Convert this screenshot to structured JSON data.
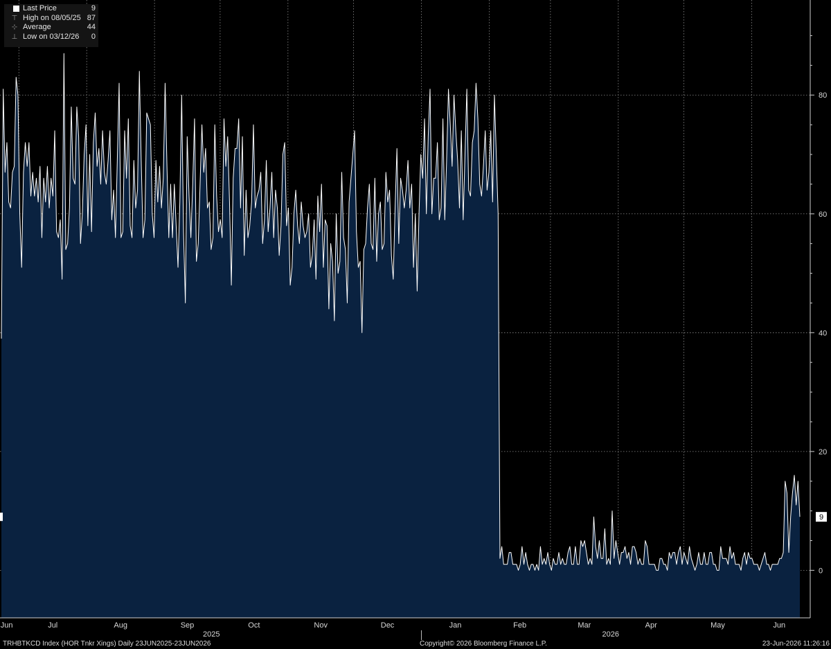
{
  "legend": {
    "last_price_label": "Last Price",
    "last_price_value": "9",
    "high_label": "High on 08/05/25",
    "high_value": "87",
    "average_label": "Average",
    "average_value": "44",
    "low_label": "Low on 03/12/26",
    "low_value": "0"
  },
  "footer": {
    "left": "TRHBTKCD Index (HOR Tnkr Xings) Daily 23JUN2025-23JUN2026",
    "middle": "Copyright© 2026 Bloomberg Finance L.P.",
    "right": "23-Jun-2026 11:26:16"
  },
  "colors": {
    "background": "#000000",
    "area_fill": "#0a2240",
    "line": "#ffffff",
    "grid": "#8c8c8c",
    "text": "#d8d8d8"
  },
  "chart_data": {
    "type": "area",
    "title": "",
    "xlabel": "",
    "ylabel": "",
    "ylim": [
      -8,
      96
    ],
    "yticks": [
      0,
      20,
      40,
      60,
      80
    ],
    "last_value_badge": "9",
    "grid": "dotted",
    "legend_position": "top-left",
    "x_month_labels": [
      "Jun",
      "Jul",
      "Aug",
      "Sep",
      "Oct",
      "Nov",
      "Dec",
      "Jan",
      "Feb",
      "Mar",
      "Apr",
      "May",
      "Jun"
    ],
    "x_year_labels": [
      "2025",
      "2026"
    ],
    "x_start": "2025-06-23",
    "x_end": "2026-06-23",
    "series": [
      {
        "values": [
          39,
          81,
          67,
          72,
          62,
          61,
          67,
          68,
          83,
          80,
          60,
          51,
          67,
          72,
          68,
          72,
          63,
          67,
          63,
          66,
          62,
          68,
          56,
          66,
          62,
          68,
          61,
          66,
          63,
          74,
          57,
          56,
          59,
          49,
          87,
          54,
          55,
          61,
          78,
          66,
          65,
          78,
          73,
          55,
          60,
          70,
          75,
          58,
          70,
          57,
          72,
          77,
          68,
          71,
          65,
          74,
          67,
          65,
          69,
          74,
          59,
          64,
          56,
          69,
          82,
          56,
          57,
          74,
          66,
          76,
          58,
          56,
          69,
          61,
          64,
          84,
          69,
          56,
          59,
          77,
          76,
          75,
          60,
          56,
          69,
          62,
          68,
          61,
          66,
          82,
          68,
          56,
          65,
          56,
          65,
          58,
          51,
          62,
          80,
          57,
          45,
          73,
          63,
          56,
          65,
          76,
          52,
          55,
          65,
          75,
          67,
          71,
          61,
          62,
          54,
          56,
          75,
          63,
          57,
          59,
          56,
          76,
          68,
          73,
          62,
          48,
          66,
          71,
          71,
          76,
          61,
          73,
          53,
          64,
          56,
          58,
          62,
          75,
          61,
          63,
          64,
          67,
          55,
          59,
          69,
          57,
          61,
          67,
          56,
          64,
          61,
          53,
          58,
          70,
          72,
          58,
          61,
          48,
          51,
          60,
          64,
          58,
          55,
          62,
          58,
          56,
          57,
          60,
          51,
          53,
          59,
          49,
          63,
          57,
          65,
          51,
          59,
          58,
          44,
          55,
          52,
          42,
          60,
          50,
          52,
          67,
          56,
          54,
          45,
          62,
          66,
          70,
          74,
          57,
          51,
          52,
          40,
          54,
          55,
          61,
          65,
          55,
          54,
          66,
          52,
          60,
          62,
          54,
          55,
          67,
          62,
          64,
          53,
          49,
          61,
          71,
          55,
          66,
          64,
          61,
          64,
          69,
          61,
          65,
          51,
          60,
          47,
          60,
          70,
          66,
          76,
          60,
          73,
          81,
          60,
          66,
          66,
          72,
          59,
          61,
          76,
          59,
          69,
          81,
          75,
          68,
          80,
          74,
          69,
          61,
          74,
          59,
          70,
          81,
          64,
          63,
          72,
          74,
          82,
          76,
          65,
          63,
          68,
          74,
          64,
          67,
          74,
          62,
          80,
          70,
          60,
          2,
          4,
          1,
          1,
          1,
          3,
          3,
          1,
          1,
          1,
          0,
          1,
          4,
          1,
          3,
          1,
          0,
          1,
          1,
          0,
          1,
          0,
          4,
          1,
          2,
          1,
          3,
          1,
          0,
          2,
          1,
          1,
          3,
          1,
          2,
          1,
          1,
          3,
          4,
          1,
          1,
          4,
          1,
          1,
          5,
          4,
          5,
          3,
          1,
          2,
          1,
          9,
          4,
          2,
          5,
          2,
          2,
          7,
          1,
          2,
          1,
          10,
          2,
          5,
          3,
          1,
          3,
          3,
          4,
          2,
          3,
          1,
          4,
          4,
          3,
          1,
          2,
          1,
          1,
          5,
          4,
          1,
          1,
          1,
          1,
          0,
          0,
          2,
          2,
          1,
          1,
          0,
          3,
          2,
          3,
          3,
          1,
          3,
          4,
          1,
          3,
          2,
          1,
          4,
          2,
          1,
          0,
          1,
          3,
          1,
          1,
          3,
          1,
          1,
          3,
          3,
          1,
          1,
          0,
          0,
          4,
          2,
          2,
          2,
          1,
          4,
          2,
          3,
          1,
          1,
          1,
          0,
          2,
          3,
          1,
          3,
          2,
          2,
          1,
          1,
          1,
          0,
          1,
          2,
          3,
          1,
          1,
          0,
          1,
          1,
          1,
          1,
          2,
          2,
          3,
          15,
          13,
          3,
          9,
          13,
          16,
          11,
          15,
          9
        ]
      }
    ]
  }
}
